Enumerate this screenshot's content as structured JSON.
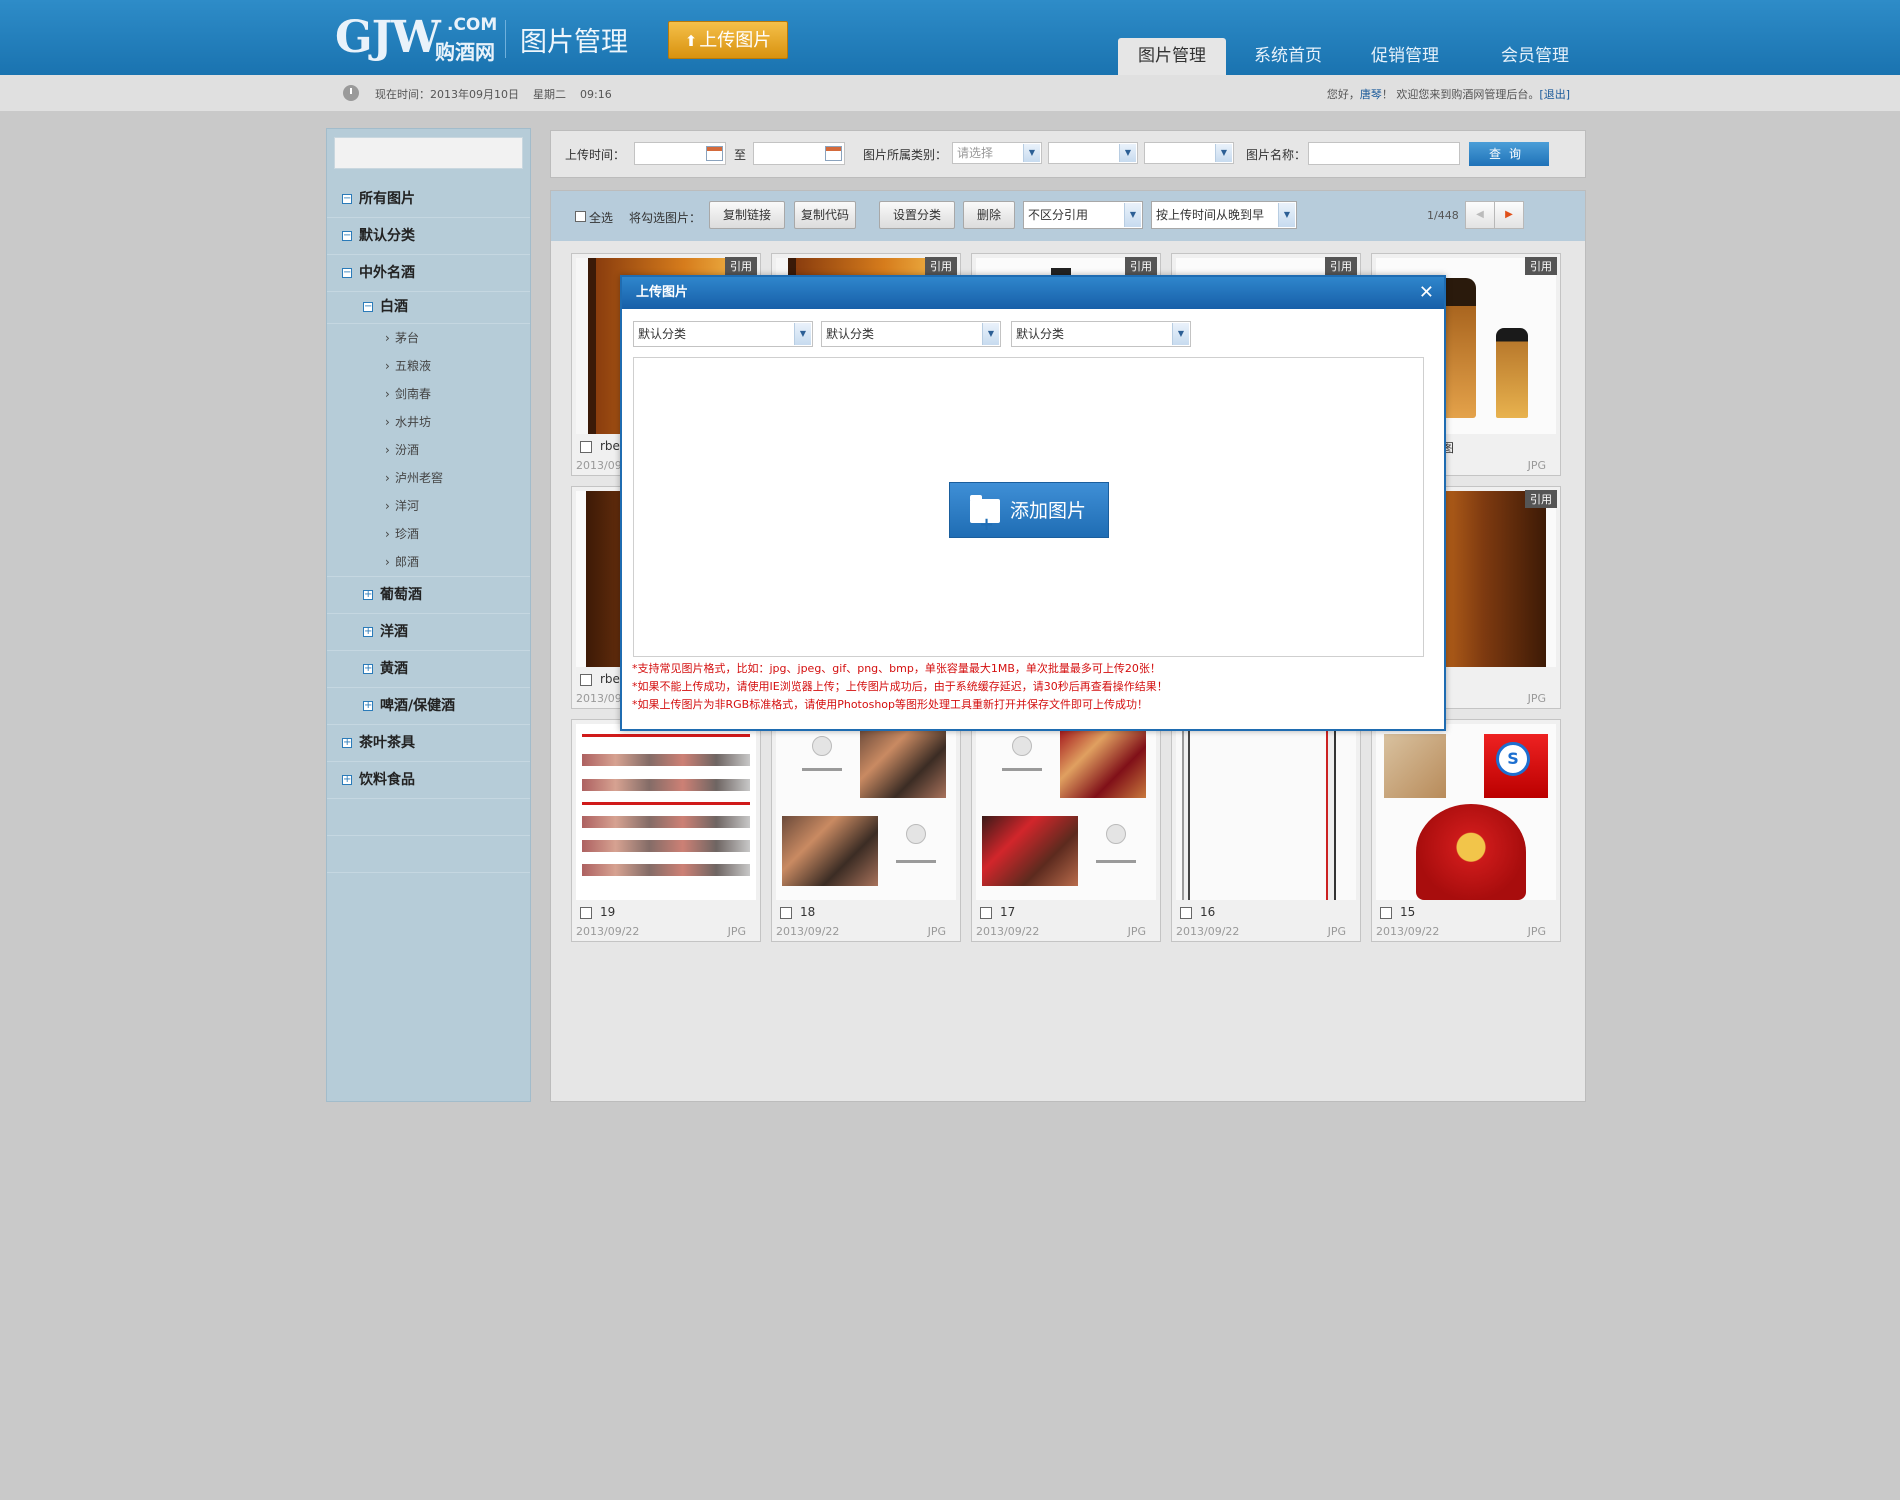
{
  "header": {
    "logo_main": "GJW",
    "logo_com": ".COM",
    "logo_cn": "购酒网",
    "title": "图片管理",
    "upload_label": "上传图片",
    "nav": [
      {
        "label": "图片管理",
        "active": true
      },
      {
        "label": "系统首页",
        "active": false
      },
      {
        "label": "促销管理",
        "active": false
      },
      {
        "label": "会员管理",
        "active": false
      }
    ]
  },
  "infobar": {
    "now_prefix": "现在时间：2013年09月10日",
    "weekday": "星期二",
    "time": "09:16",
    "greeting": "您好，",
    "user": "唐琴",
    "welcome": "！ 欢迎您来到购酒网管理后台。",
    "logout": "[退出]"
  },
  "sidebar": {
    "search_value": "",
    "nodes": [
      {
        "label": "所有图片",
        "toggle": "−"
      },
      {
        "label": "默认分类",
        "toggle": "−"
      },
      {
        "label": "中外名酒",
        "toggle": "−"
      },
      {
        "label": "白酒",
        "toggle": "−"
      },
      {
        "label": "葡萄酒",
        "toggle": "+"
      },
      {
        "label": "洋酒",
        "toggle": "+"
      },
      {
        "label": "黄酒",
        "toggle": "+"
      },
      {
        "label": "啤酒/保健酒",
        "toggle": "+"
      },
      {
        "label": "茶叶茶具",
        "toggle": "+"
      },
      {
        "label": "饮料食品",
        "toggle": "+"
      }
    ],
    "leaves": [
      "茅台",
      "五粮液",
      "剑南春",
      "水井坊",
      "汾酒",
      "泸州老窖",
      "洋河",
      "珍酒",
      "郎酒"
    ]
  },
  "filter": {
    "upload_time_label": "上传时间：",
    "to_label": "至",
    "category_label": "图片所属类别：",
    "category_placeholder": "请选择",
    "name_label": "图片名称：",
    "search_label": "查询"
  },
  "toolbar": {
    "select_all": "全选",
    "selected_label": "将勾选图片：",
    "copy_link": "复制链接",
    "copy_code": "复制代码",
    "set_category": "设置分类",
    "delete": "删除",
    "ref_filter": "不区分引用",
    "sort": "按上传时间从晚到早",
    "page": "1/448",
    "prev": "◀",
    "next": "▶"
  },
  "cards": {
    "quote": "引用",
    "row1": [
      {
        "name": "rbe",
        "date": "2013/09",
        "type": ""
      },
      {
        "name": "",
        "date": "",
        "type": ""
      },
      {
        "name": "",
        "date": "",
        "type": ""
      },
      {
        "name": "",
        "date": "",
        "type": ""
      },
      {
        "name": "图",
        "date": "",
        "type": "JPG"
      }
    ],
    "row2": [
      {
        "name": "rbe",
        "date": "2013/09",
        "type": ""
      },
      {
        "name": "",
        "date": "",
        "type": "JPG"
      }
    ],
    "row3": [
      {
        "name": "19",
        "date": "2013/09/22",
        "type": "JPG"
      },
      {
        "name": "18",
        "date": "2013/09/22",
        "type": "JPG"
      },
      {
        "name": "17",
        "date": "2013/09/22",
        "type": "JPG"
      },
      {
        "name": "16",
        "date": "2013/09/22",
        "type": "JPG"
      },
      {
        "name": "15",
        "date": "2013/09/22",
        "type": "JPG"
      }
    ]
  },
  "modal": {
    "title": "上传图片",
    "close": "✕",
    "selects": [
      "默认分类",
      "默认分类",
      "默认分类"
    ],
    "add_label": "添加图片",
    "notes": [
      "*支持常见图片格式，比如：jpg、jpeg、gif、png、bmp，单张容量最大1MB，单次批量最多可上传20张！",
      "*如果不能上传成功，请使用IE浏览器上传；上传图片成功后，由于系统缓存延迟，请30秒后再查看操作结果！",
      "*如果上传图片为非RGB标准格式，请使用Photoshop等图形处理工具重新打开并保存文件即可上传成功！"
    ]
  },
  "colors": {
    "header_blue": "#1a73b0",
    "accent_orange": "#e3a21f",
    "notice_red": "#d40f0f",
    "sidebar_bg": "#b6ccd8"
  }
}
